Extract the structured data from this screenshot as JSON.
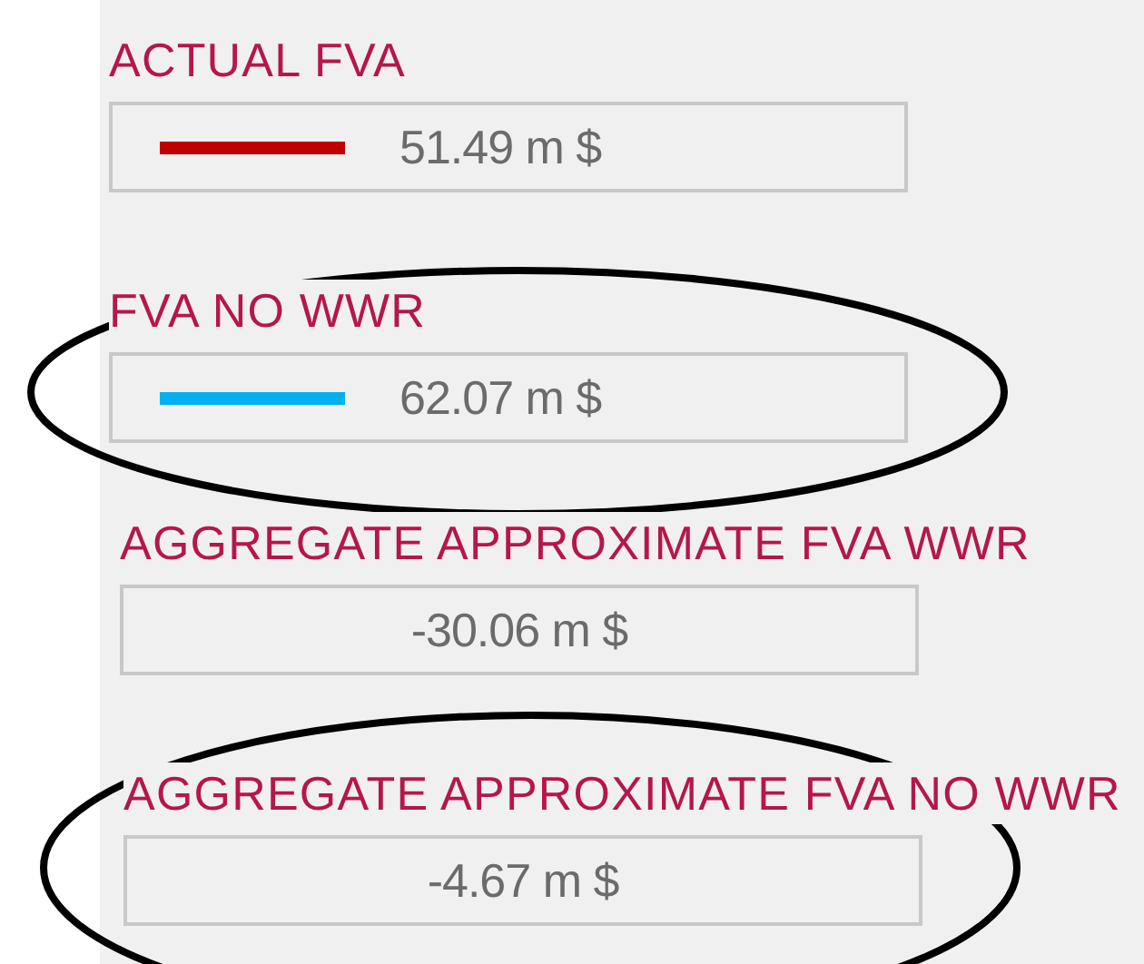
{
  "fields": [
    {
      "label": "ACTUAL FVA",
      "value": "51.49 m $",
      "kind": "legend",
      "color": "#c00000",
      "highlighted": false
    },
    {
      "label": "FVA NO WWR",
      "value": "62.07 m $",
      "kind": "legend",
      "color": "#00b0f0",
      "highlighted": true
    },
    {
      "label": "AGGREGATE APPROXIMATE FVA WWR",
      "value": "-30.06 m $",
      "kind": "plain",
      "highlighted": false
    },
    {
      "label": "AGGREGATE APPROXIMATE FVA NO WWR",
      "value": "-4.67 m $",
      "kind": "plain",
      "highlighted": true
    }
  ]
}
